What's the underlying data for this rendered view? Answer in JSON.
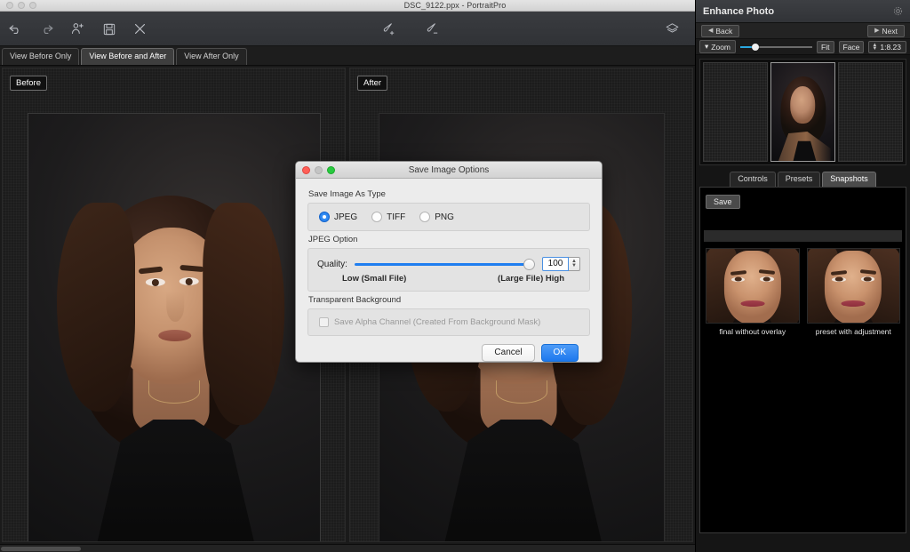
{
  "window": {
    "title": "DSC_9122.ppx - PortraitPro",
    "traffic_lights": [
      "close",
      "minimize",
      "zoom"
    ]
  },
  "toolbar": {
    "left_icons": [
      {
        "name": "undo-icon",
        "label": "Undo"
      },
      {
        "name": "redo-icon",
        "label": "Redo"
      },
      {
        "name": "add-person-icon",
        "label": "Add Person"
      },
      {
        "name": "save-icon",
        "label": "Save"
      },
      {
        "name": "close-image-icon",
        "label": "Close Image"
      }
    ],
    "mid_icons": [
      {
        "name": "brush-add-icon",
        "label": "Brush Add"
      },
      {
        "name": "brush-remove-icon",
        "label": "Brush Remove"
      }
    ],
    "right_icons": [
      {
        "name": "layers-icon",
        "label": "Layers"
      }
    ]
  },
  "view_tabs": [
    {
      "label": "View Before Only",
      "active": false
    },
    {
      "label": "View Before and After",
      "active": true
    },
    {
      "label": "View After Only",
      "active": false
    }
  ],
  "canvas": {
    "before_label": "Before",
    "after_label": "After"
  },
  "right_panel": {
    "title": "Enhance Photo",
    "gear_icon": "gear-icon",
    "back_label": "Back",
    "next_label": "Next",
    "zoom_label": "Zoom",
    "fit_label": "Fit",
    "face_label": "Face",
    "zoom_ratio": "1:8.23",
    "zoom_slider_percent": 21,
    "tabs": [
      {
        "label": "Controls",
        "active": false
      },
      {
        "label": "Presets",
        "active": false
      },
      {
        "label": "Snapshots",
        "active": true
      }
    ],
    "snapshots_panel": {
      "save_label": "Save",
      "items": [
        {
          "caption": "final without overlay"
        },
        {
          "caption": "preset with adjustment"
        }
      ]
    }
  },
  "dialog": {
    "title": "Save Image Options",
    "section_type_label": "Save Image As Type",
    "file_types": [
      {
        "label": "JPEG",
        "selected": true
      },
      {
        "label": "TIFF",
        "selected": false
      },
      {
        "label": "PNG",
        "selected": false
      }
    ],
    "section_jpeg_label": "JPEG Option",
    "quality_label": "Quality:",
    "quality_value": "100",
    "quality_percent": 100,
    "quality_low_label": "Low (Small File)",
    "quality_high_label": "(Large File) High",
    "section_transparent_label": "Transparent Background",
    "alpha_checkbox_label": "Save Alpha Channel (Created From Background Mask)",
    "alpha_checked": false,
    "cancel_label": "Cancel",
    "ok_label": "OK"
  },
  "colors": {
    "accent_blue": "#1f7ef0",
    "ok_button": "#2a86f0",
    "zoom_slider": "#2aa8e0",
    "panel_bg": "#151515",
    "dialog_bg": "#ececec"
  }
}
